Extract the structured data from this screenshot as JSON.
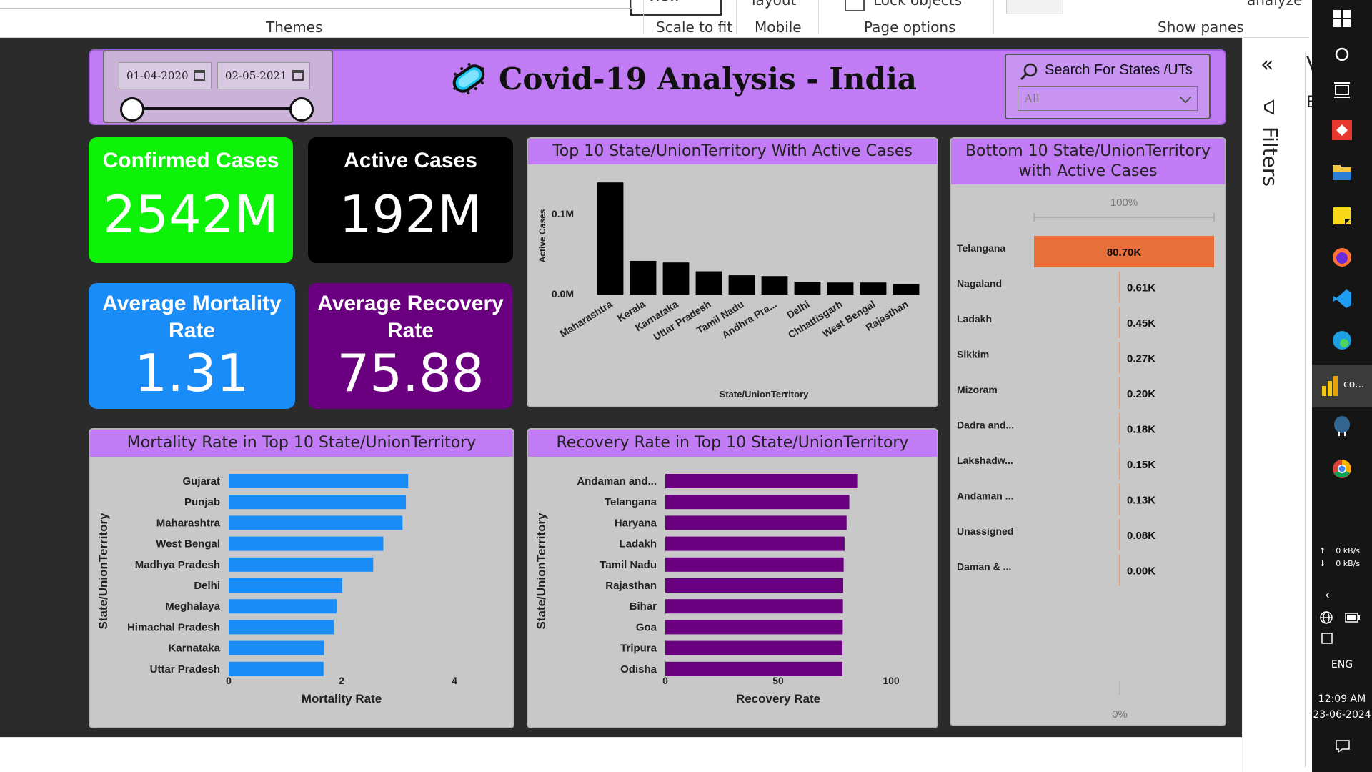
{
  "ribbon": {
    "themes": "Themes",
    "scale_to_fit": "Scale to fit",
    "mobile": "Mobile",
    "page_options": "Page options",
    "show_panes": "Show panes",
    "view_top": "view",
    "layout_top": "layout",
    "lock_objects": "Lock objects",
    "analyze_top": "analyze"
  },
  "header": {
    "title": "Covid-19 Analysis - India",
    "date_from": "01-04-2020",
    "date_to": "02-05-2021",
    "search_label": "Search For States /UTs",
    "dropdown_value": "All"
  },
  "kpis": {
    "confirmed": {
      "title": "Confirmed Cases",
      "value": "2542M",
      "color": "#0ef20a"
    },
    "active": {
      "title": "Active Cases",
      "value": "192M",
      "color": "#000000"
    },
    "mortality": {
      "title_l1": "Average Mortality",
      "title_l2": "Rate",
      "value": "1.31",
      "color": "#1a8cf7"
    },
    "recovery": {
      "title_l1": "Average Recovery",
      "title_l2": "Rate",
      "value": "75.88",
      "color": "#6a0080"
    }
  },
  "top_active": {
    "title": "Top 10 State/UnionTerritory With Active Cases",
    "ylabel": "Active Cases",
    "xlabel": "State/UnionTerritory"
  },
  "bottom_active": {
    "title_l1": "Bottom 10 State/UnionTerritory",
    "title_l2": "with Active Cases",
    "top_tick": "100%",
    "bottom_tick": "0%"
  },
  "mortality_chart": {
    "title": "Mortality Rate in Top 10 State/UnionTerritory",
    "ylabel": "State/UnionTerritory",
    "xlabel": "Mortality Rate"
  },
  "recovery_chart": {
    "title": "Recovery Rate in Top 10 State/UnionTerritory",
    "ylabel": "State/UnionTerritory",
    "xlabel": "Recovery Rate"
  },
  "sidepane": {
    "filters": "Filters",
    "letter_v": "V",
    "letter_b": "B"
  },
  "taskbar": {
    "app_label": "co...",
    "net_up": "0 kB/s",
    "net_down": "0 kB/s",
    "lang": "ENG",
    "time": "12:09 AM",
    "date": "23-06-2024"
  },
  "colors": {
    "header": "#c17bf4",
    "mortality_bar": "#1a8cf7",
    "recovery_bar": "#6a0080",
    "active_bar": "#000000",
    "highlight_bar": "#e8703a"
  },
  "chart_data": [
    {
      "type": "bar",
      "title": "Top 10 State/UnionTerritory With Active Cases",
      "xlabel": "State/UnionTerritory",
      "ylabel": "Active Cases",
      "categories": [
        "Maharashtra",
        "Kerala",
        "Karnataka",
        "Uttar Pradesh",
        "Tamil Nadu",
        "Andhra Pra...",
        "Delhi",
        "Chhattisgarh",
        "West Bengal",
        "Rajasthan"
      ],
      "values": [
        140000,
        42000,
        40000,
        29000,
        24000,
        23000,
        16000,
        15000,
        15000,
        13000
      ],
      "yticks": [
        {
          "value": 0,
          "label": "0.0M"
        },
        {
          "value": 100000,
          "label": "0.1M"
        }
      ],
      "ylim": [
        0,
        150000
      ]
    },
    {
      "type": "bar",
      "orientation": "horizontal",
      "title": "Bottom 10 State/UnionTerritory with Active Cases",
      "categories": [
        "Telangana",
        "Nagaland",
        "Ladakh",
        "Sikkim",
        "Mizoram",
        "Dadra and...",
        "Lakshadw...",
        "Andaman ...",
        "Unassigned",
        "Daman & ..."
      ],
      "values": [
        80700,
        610,
        450,
        270,
        200,
        180,
        150,
        130,
        80,
        0
      ],
      "labels": [
        "80.70K",
        "0.61K",
        "0.45K",
        "0.27K",
        "0.20K",
        "0.18K",
        "0.15K",
        "0.13K",
        "0.08K",
        "0.00K"
      ]
    },
    {
      "type": "bar",
      "orientation": "horizontal",
      "title": "Mortality Rate in Top 10 State/UnionTerritory",
      "xlabel": "Mortality Rate",
      "ylabel": "State/UnionTerritory",
      "categories": [
        "Gujarat",
        "Punjab",
        "Maharashtra",
        "West Bengal",
        "Madhya Pradesh",
        "Delhi",
        "Meghalaya",
        "Himachal Pradesh",
        "Karnataka",
        "Uttar Pradesh"
      ],
      "values": [
        3.18,
        3.14,
        3.08,
        2.74,
        2.56,
        2.01,
        1.91,
        1.86,
        1.69,
        1.68
      ],
      "xticks": [
        0,
        2,
        4
      ],
      "xlim": [
        0,
        4
      ]
    },
    {
      "type": "bar",
      "orientation": "horizontal",
      "title": "Recovery Rate in Top 10 State/UnionTerritory",
      "xlabel": "Recovery Rate",
      "ylabel": "State/UnionTerritory",
      "categories": [
        "Andaman and...",
        "Telangana",
        "Haryana",
        "Ladakh",
        "Tamil Nadu",
        "Rajasthan",
        "Bihar",
        "Goa",
        "Tripura",
        "Odisha"
      ],
      "values": [
        85.0,
        81.5,
        80.3,
        79.4,
        79.0,
        78.8,
        78.7,
        78.6,
        78.5,
        78.4
      ],
      "xticks": [
        0,
        50,
        100
      ],
      "xlim": [
        0,
        100
      ]
    }
  ]
}
